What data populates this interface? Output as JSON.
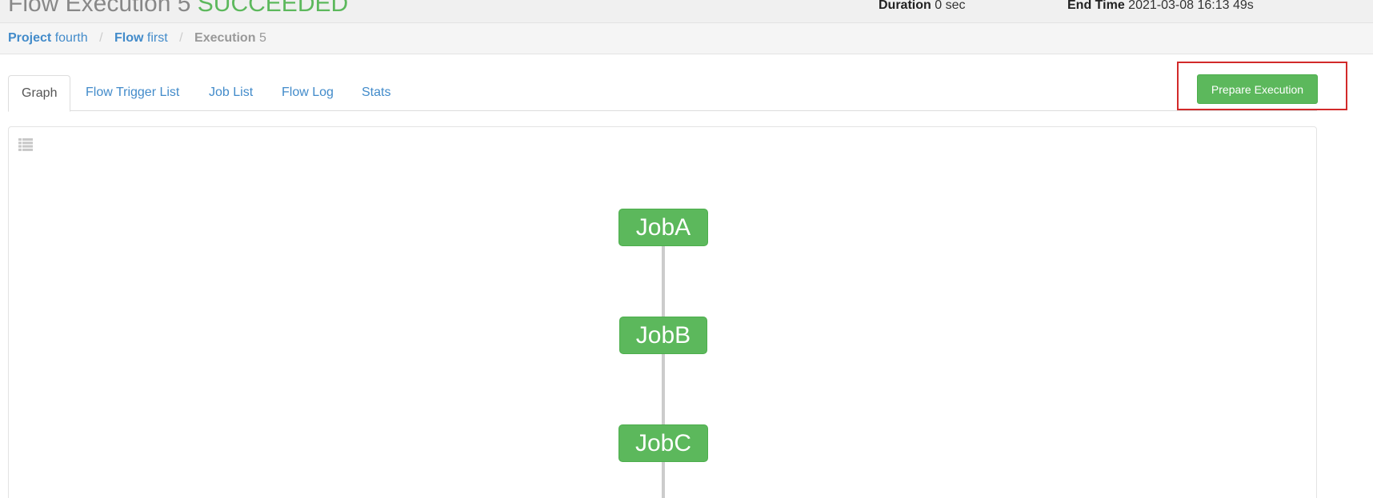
{
  "header": {
    "title_prefix": "Flow Execution 5",
    "title_status": "SUCCEEDED",
    "duration_label": "Duration",
    "duration_value": "0 sec",
    "endtime_label": "End Time",
    "endtime_value": "2021-03-08 16:13 49s"
  },
  "breadcrumb": {
    "project_label": "Project",
    "project_value": "fourth",
    "flow_label": "Flow",
    "flow_value": "first",
    "execution_label": "Execution",
    "execution_value": "5",
    "separator": "/"
  },
  "tabs": [
    {
      "label": "Graph",
      "active": true
    },
    {
      "label": "Flow Trigger List"
    },
    {
      "label": "Job List"
    },
    {
      "label": "Flow Log"
    },
    {
      "label": "Stats"
    }
  ],
  "actions": {
    "prepare_execution_label": "Prepare Execution"
  },
  "graph": {
    "nodes": [
      {
        "label": "JobA",
        "status": "succeeded"
      },
      {
        "label": "JobB",
        "status": "succeeded"
      },
      {
        "label": "JobC",
        "status": "succeeded"
      }
    ],
    "toolbar_icon": "list-icon"
  },
  "colors": {
    "success": "#5cb85c",
    "link": "#428bca",
    "highlight": "#d22a2a"
  }
}
